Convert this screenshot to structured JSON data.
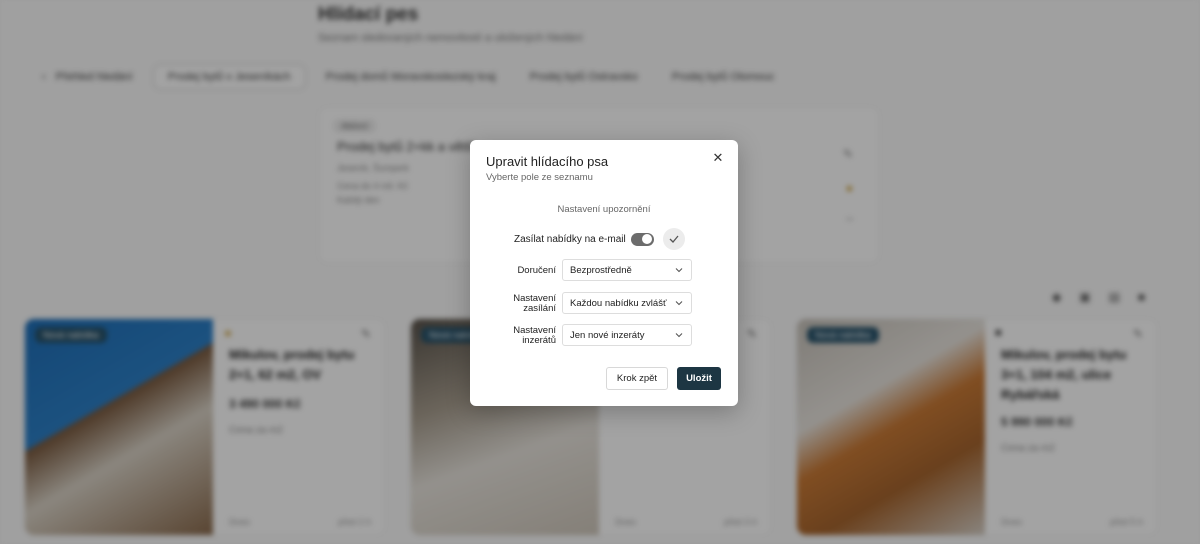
{
  "background": {
    "page_title": "Hlídací pes",
    "page_subtitle": "Seznam sledovaných nemovitostí a uložených hledání",
    "tabs": [
      {
        "label": "Přehled hledání"
      },
      {
        "label": "Prodej bytů v Jeseníkách"
      },
      {
        "label": "Prodej domů Moravskoslezský kraj"
      },
      {
        "label": "Prodej bytů Ostravsko"
      },
      {
        "label": "Prodej bytů Olomouc"
      }
    ],
    "watch": {
      "badge": "Aktivní",
      "title": "Prodej bytů 2+kk a větší",
      "line1": "Jeseník, Šumperk",
      "line2": "Cena do 4 mil. Kč",
      "line3": "Každý den"
    },
    "cards": [
      {
        "photo_badge": "Nová nabídka",
        "title": "Mikulov, prodej bytu 2+1, 62 m2, OV",
        "price": "3 490 000 Kč",
        "area": "Cena za m2",
        "foot_left": "Dnes",
        "foot_right": "před 2 h"
      },
      {
        "photo_badge": "Nová nabídka",
        "title": "",
        "price": "",
        "area": "",
        "foot_left": "Dnes",
        "foot_right": "před 3 h"
      },
      {
        "photo_badge": "Nová nabídka",
        "title": "Mikulov, prodej bytu 3+1, 104 m2, ulice Rybářská",
        "price": "5 990 000 Kč",
        "area": "Cena za m2",
        "foot_left": "Dnes",
        "foot_right": "před 5 h"
      }
    ]
  },
  "modal": {
    "title": "Upravit hlídacího psa",
    "subtitle": "Vyberte pole ze seznamu",
    "section_heading": "Nastavení upozornění",
    "email_label": "Zasílat nabídky na e-mail",
    "email_enabled": true,
    "fields": {
      "delivery": {
        "label": "Doručení",
        "value": "Bezprostředně"
      },
      "sending": {
        "label_line1": "Nastavení",
        "label_line2": "zasílání",
        "value": "Každou nabídku zvlášť"
      },
      "listings": {
        "label_line1": "Nastavení",
        "label_line2": "inzerátů",
        "value": "Jen nové inzeráty"
      }
    },
    "buttons": {
      "back": "Krok zpět",
      "save": "Uložit"
    }
  },
  "icons": {
    "close": "close-icon",
    "check": "check-icon",
    "chevron": "chevron-down-icon"
  },
  "colors": {
    "primary_button": "#1d3643",
    "toggle_on": "#6c6c6c",
    "overlay": "rgba(0,0,0,0.36)"
  }
}
